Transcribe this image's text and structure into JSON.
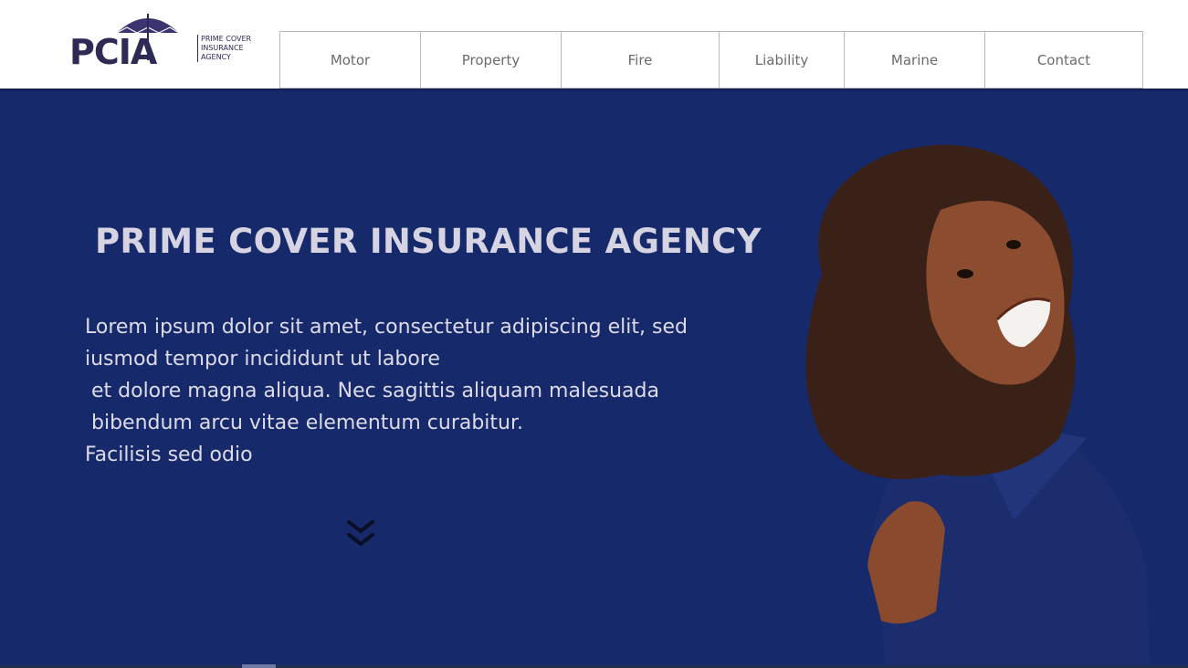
{
  "brand": {
    "logo_letters": "PCIA",
    "logo_lines": [
      "PRIME COVER",
      "INSURANCE",
      "AGENCY"
    ]
  },
  "nav": {
    "items": [
      {
        "label": "Motor"
      },
      {
        "label": "Property"
      },
      {
        "label": "Fire"
      },
      {
        "label": "Liability"
      },
      {
        "label": "Marine"
      },
      {
        "label": "Contact"
      }
    ]
  },
  "hero": {
    "title": "PRIME COVER INSURANCE AGENCY",
    "lines": [
      "Lorem ipsum dolor sit amet, consectetur adipiscing elit, sed",
      "iusmod tempor incididunt ut labore",
      " et dolore magna aliqua. Nec sagittis aliquam malesuada",
      " bibendum arcu vitae elementum curabitur.",
      "Facilisis sed odio"
    ],
    "scroll_icon": "double-chevron-down-icon"
  },
  "colors": {
    "background": "#16296a",
    "header": "#ffffff",
    "logo": "#2d2a55",
    "title_text": "#d6d3e3"
  }
}
